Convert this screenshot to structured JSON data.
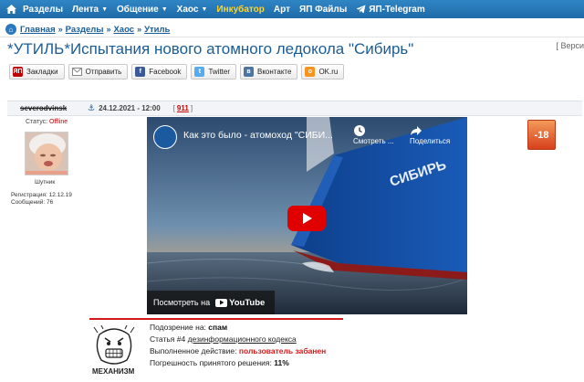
{
  "nav": {
    "items": [
      {
        "label": "Разделы",
        "caret": false
      },
      {
        "label": "Лента",
        "caret": true
      },
      {
        "label": "Общение",
        "caret": true
      },
      {
        "label": "Хаос",
        "caret": true
      },
      {
        "label": "Инкубатор",
        "caret": false,
        "accent": true
      },
      {
        "label": "Арт",
        "caret": false
      },
      {
        "label": "ЯП Файлы",
        "caret": false
      },
      {
        "label": "ЯП-Telegram",
        "caret": false,
        "icon": "telegram-icon"
      }
    ],
    "bg_color": "#2576b6",
    "accent_color": "#ffd428"
  },
  "breadcrumb": {
    "items": [
      "Главная",
      "Разделы",
      "Хаос",
      "Утиль"
    ],
    "separator": "»"
  },
  "topic": {
    "title": "*УТИЛЬ*Испытания нового атомного ледокола \"Сибирь\"",
    "version_link": "[ Верси"
  },
  "share_buttons": [
    {
      "label": "Закладки",
      "icon": "yap-icon",
      "color": "#c00000"
    },
    {
      "label": "Отправить",
      "icon": "mail-icon",
      "color": "#888888"
    },
    {
      "label": "Facebook",
      "icon": "facebook-icon",
      "color": "#3b5998"
    },
    {
      "label": "Twitter",
      "icon": "twitter-icon",
      "color": "#55acee"
    },
    {
      "label": "Вконтакте",
      "icon": "vk-icon",
      "color": "#4c75a3"
    },
    {
      "label": "OK.ru",
      "icon": "ok-icon",
      "color": "#f7931e"
    }
  ],
  "post": {
    "author": "severodvinsk",
    "date": "24.12.2021 - 12:00",
    "number": "911",
    "status_label": "Статус:",
    "status_value": "Offline",
    "rank": "Шутник",
    "reg_label": "Регистрация:",
    "reg_date": "12.12.19",
    "msgs_label": "Сообщений:",
    "msgs_count": "76",
    "rating": "-18"
  },
  "video": {
    "title": "Как это было - атомоход \"СИБИ...",
    "watch_later": "Смотреть ...",
    "share": "Поделиться",
    "ship_name": "СИБИРЬ",
    "watch_on": "Посмотреть на",
    "youtube": "YouTube"
  },
  "moderation": {
    "label": "МЕХАНИЗМ",
    "suspicion_label": "Подозрение на:",
    "suspicion_value": "спам",
    "article_prefix": "Статья #4",
    "article_link": "дезинформационного кодекса",
    "action_label": "Выполненное действие:",
    "action_value": "пользователь забанен",
    "error_label": "Погрешность принятого решения:",
    "error_value": "11%"
  }
}
